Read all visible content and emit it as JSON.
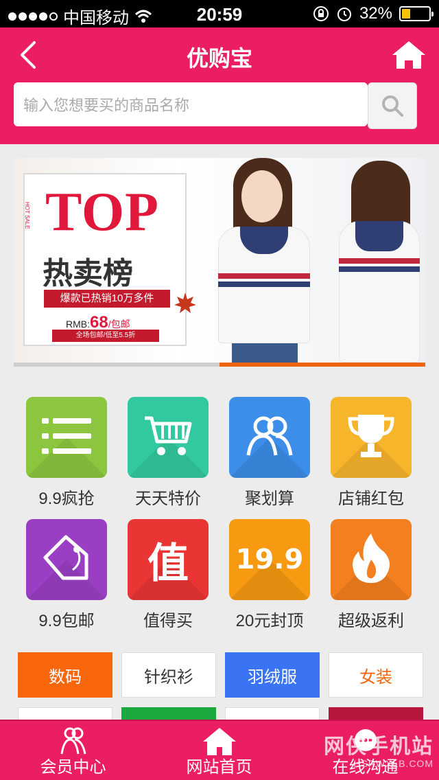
{
  "status_bar": {
    "carrier": "中国移动",
    "time": "20:59",
    "battery_percent": "32%",
    "battery_level": 0.32,
    "signal_bars": 4,
    "icons": [
      "wifi-icon",
      "rotation-lock-icon",
      "alarm-icon",
      "battery-icon"
    ]
  },
  "header": {
    "title": "优购宝",
    "back_icon": "chevron-left-icon",
    "home_icon": "home-icon",
    "search_placeholder": "输入您想要买的商品名称",
    "search_icon": "search-icon"
  },
  "banner": {
    "headline": "TOP",
    "subhead": "热卖榜",
    "hot_sale": "HOT SALE",
    "tagline": "爆款已热销10万多件",
    "price_prefix": "RMB:",
    "price_value": "68",
    "price_suffix": "/包邮",
    "strip_text": "全场包邮/低至5.5折",
    "slide_index": 2,
    "slide_count": 2
  },
  "grid": [
    {
      "label": "9.9疯抢",
      "icon": "list-icon",
      "color": "#8cc63f"
    },
    {
      "label": "天天特价",
      "icon": "shopping-cart-icon",
      "color": "#33c9a0"
    },
    {
      "label": "聚划算",
      "icon": "group-users-icon",
      "color": "#3d8ee8"
    },
    {
      "label": "店铺红包",
      "icon": "trophy-icon",
      "color": "#f7b52c"
    },
    {
      "label": "9.9包邮",
      "icon": "price-tag-icon",
      "color": "#9a3fc4"
    },
    {
      "label": "值得买",
      "icon": "worth-icon",
      "color": "#ea3535",
      "glyph": "值"
    },
    {
      "label": "20元封顶",
      "icon": "price-19-9-icon",
      "color": "#f79a12",
      "glyph": "19.9"
    },
    {
      "label": "超级返利",
      "icon": "flame-icon",
      "color": "#f47f1f"
    }
  ],
  "categories": [
    {
      "label": "数码",
      "bg": "#f8660c",
      "fg": "#ffffff"
    },
    {
      "label": "针织衫",
      "bg": "#ffffff",
      "fg": "#333333"
    },
    {
      "label": "羽绒服",
      "bg": "#3b74f2",
      "fg": "#ffffff"
    },
    {
      "label": "女装",
      "bg": "#ffffff",
      "fg": "#f8660c"
    }
  ],
  "categories_row2": [
    {
      "bg": "#ffffff"
    },
    {
      "bg": "#1aa83f"
    },
    {
      "bg": "#ffffff"
    },
    {
      "bg": "#b5163b"
    }
  ],
  "tabbar": {
    "tabs": [
      {
        "label": "会员中心",
        "icon": "member-icon"
      },
      {
        "label": "网站首页",
        "icon": "home-icon"
      },
      {
        "label": "在线沟通",
        "icon": "chat-icon"
      }
    ]
  },
  "watermark": {
    "text": "网侠手机站",
    "url": "HSRWXLB.COM"
  },
  "colors": {
    "brand": "#eb1e63",
    "accent_orange": "#f06414"
  }
}
